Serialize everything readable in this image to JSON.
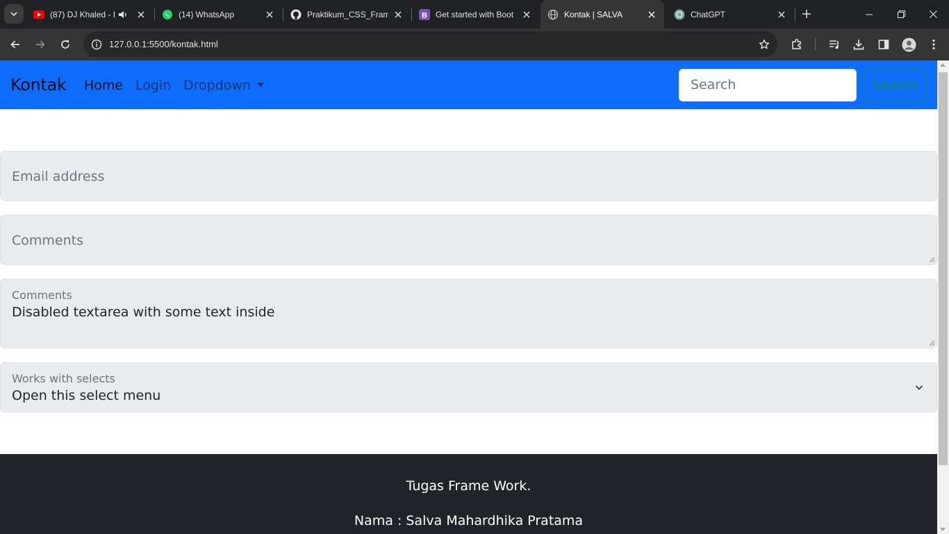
{
  "browser": {
    "tabs": [
      {
        "title": "(87) DJ Khaled - I",
        "icon": "youtube-icon",
        "audio": true
      },
      {
        "title": "(14) WhatsApp",
        "icon": "whatsapp-icon"
      },
      {
        "title": "Praktikum_CSS_Frame",
        "icon": "github-icon"
      },
      {
        "title": "Get started with Boot",
        "icon": "bootstrap-icon"
      },
      {
        "title": "Kontak | SALVA",
        "icon": "globe-icon",
        "active": true
      },
      {
        "title": "ChatGPT",
        "icon": "chatgpt-icon"
      }
    ],
    "address": {
      "host": "127.0.0.1:5500",
      "path": "/kontak.html"
    }
  },
  "page": {
    "navbar": {
      "brand": "Kontak",
      "links": [
        "Home",
        "Login",
        "Dropdown"
      ],
      "search_placeholder": "Search",
      "search_button": "Search",
      "colors": {
        "background": "#0d6efd",
        "search_button": "#198754"
      }
    },
    "form": {
      "email_placeholder": "Email address",
      "comments_placeholder": "Comments",
      "disabled_label": "Comments",
      "disabled_value": "Disabled textarea with some text inside",
      "select_label": "Works with selects",
      "select_value": "Open this select menu"
    },
    "footer": {
      "line1": "Tugas Frame Work.",
      "line2": "Nama : Salva Mahardhika Pratama"
    }
  }
}
